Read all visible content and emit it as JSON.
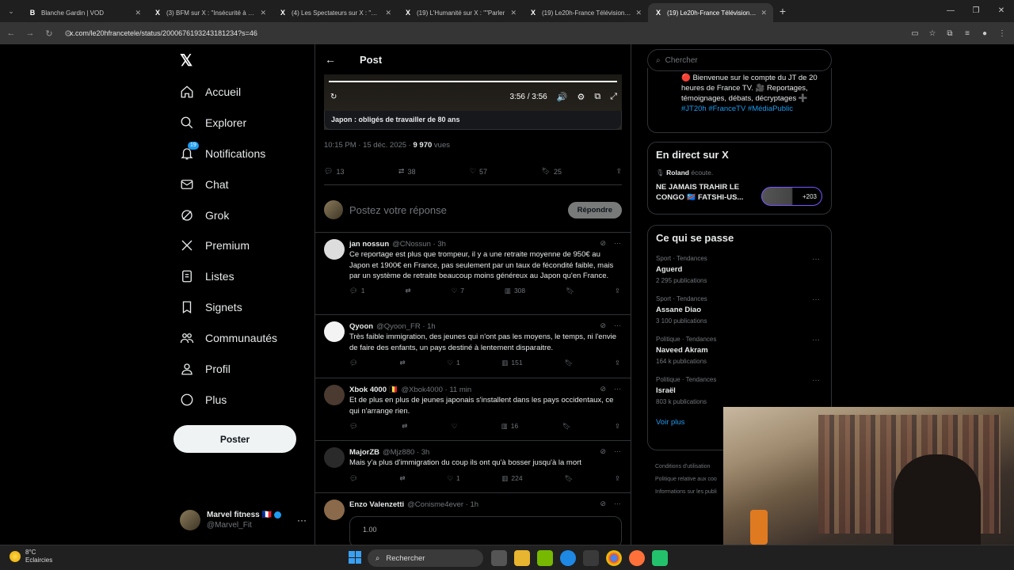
{
  "browser": {
    "tabs": [
      {
        "icon": "B",
        "title": "Blanche Gardin | VOD"
      },
      {
        "icon": "X",
        "title": "(3) BFM sur X : \"Insécurité à Ma"
      },
      {
        "icon": "X",
        "title": "(4) Les Spectateurs sur X : \"🔴 B"
      },
      {
        "icon": "X",
        "title": "(19) L'Humanité sur X : \"\"Parler"
      },
      {
        "icon": "X",
        "title": "(19) Le20h-France Télévisions s"
      },
      {
        "icon": "X",
        "title": "(19) Le20h-France Télévisions s"
      }
    ],
    "url": "x.com/le20hfrancetele/status/2000676193243181234?s=46"
  },
  "sidebar": {
    "logo": "𝕏",
    "items": [
      {
        "label": "Accueil"
      },
      {
        "label": "Explorer"
      },
      {
        "label": "Notifications",
        "badge": "19"
      },
      {
        "label": "Chat"
      },
      {
        "label": "Grok"
      },
      {
        "label": "Premium"
      },
      {
        "label": "Listes"
      },
      {
        "label": "Signets"
      },
      {
        "label": "Communautés"
      },
      {
        "label": "Profil"
      },
      {
        "label": "Plus"
      }
    ],
    "post_button": "Poster",
    "account": {
      "name": "Marvel fitness 🇫🇷",
      "handle": "@Marvel_Fit",
      "more": "···"
    }
  },
  "main": {
    "back": "←",
    "title": "Post",
    "video": {
      "time": "3:56 / 3:56",
      "progress": 1.0,
      "caption": "Japon : obligés de travailler de 80 ans"
    },
    "meta": {
      "time": "10:15 PM · 15 déc. 2025 · ",
      "views_count": "9 970",
      "views_label": " vues"
    },
    "stats": {
      "replies": "13",
      "reposts": "38",
      "likes": "57",
      "bookmarks": "25"
    },
    "reply_placeholder": "Postez votre réponse",
    "reply_button": "Répondre",
    "replies": [
      {
        "name": "jan nossun",
        "handle": "@CNossun · 3h",
        "text": "Ce reportage est plus que trompeur, il y a une retraite moyenne de 950€ au Japon et 1900€ en France, pas seulement par un taux de fécondité faible, mais par un système de retraite beaucoup moins généreux au Japon qu'en France.",
        "replies": "1",
        "reposts": "",
        "likes": "7",
        "views": "308"
      },
      {
        "name": "Qyoon",
        "handle": "@Qyoon_FR · 1h",
        "text": "Très faible immigration, des jeunes qui n'ont pas les moyens, le temps, ni l'envie de faire des enfants, un pays destiné à lentement disparaitre.",
        "replies": "",
        "reposts": "",
        "likes": "1",
        "views": "151"
      },
      {
        "name": "Xbok 4000 🇧🇪",
        "handle": "@Xbok4000 · 11 min",
        "text": "Et de plus en plus de jeunes japonais s'installent dans les pays occidentaux, ce qui n'arrange rien.",
        "replies": "",
        "reposts": "",
        "likes": "",
        "views": "16"
      },
      {
        "name": "MajorZB",
        "handle": "@Mjz880 · 3h",
        "text": "Mais y'a plus d'immigration du coup ils ont qu'à bosser jusqu'à la mort",
        "replies": "",
        "reposts": "",
        "likes": "1",
        "views": "224"
      },
      {
        "name": "Enzo Valenzetti",
        "handle": "@Conisme4ever · 1h",
        "text": "",
        "embed_value": "1.00"
      }
    ]
  },
  "right": {
    "search_placeholder": "Chercher",
    "bio": {
      "text": "🔴 Bienvenue sur le compte du JT de 20 heures de France TV. 🎥 Reportages, témoignages, débats, décryptages ➕",
      "tags": "#JT20h #FranceTV #MédiaPublic"
    },
    "live": {
      "title": "En direct sur X",
      "listener": "Roland",
      "listener_suffix": " écoute.",
      "space_title": "NE JAMAIS TRAHIR LE CONGO 🇨🇩 FATSHI-US...",
      "count": "+203"
    },
    "trends_title": "Ce qui se passe",
    "trends": [
      {
        "cat": "Sport · Tendances",
        "name": "Aguerd",
        "count": "2 295 publications"
      },
      {
        "cat": "Sport · Tendances",
        "name": "Assane Diao",
        "count": "3 100 publications"
      },
      {
        "cat": "Politique · Tendances",
        "name": "Naveed Akram",
        "count": "164 k publications"
      },
      {
        "cat": "Politique · Tendances",
        "name": "Israël",
        "count": "803 k publications"
      }
    ],
    "see_more": "Voir plus",
    "footer": [
      "Conditions d'utilisation",
      "Politique relative aux coo",
      "Informations sur les publi"
    ]
  },
  "taskbar": {
    "temp": "8°C",
    "weather": "Eclaircies",
    "search": "Rechercher"
  }
}
